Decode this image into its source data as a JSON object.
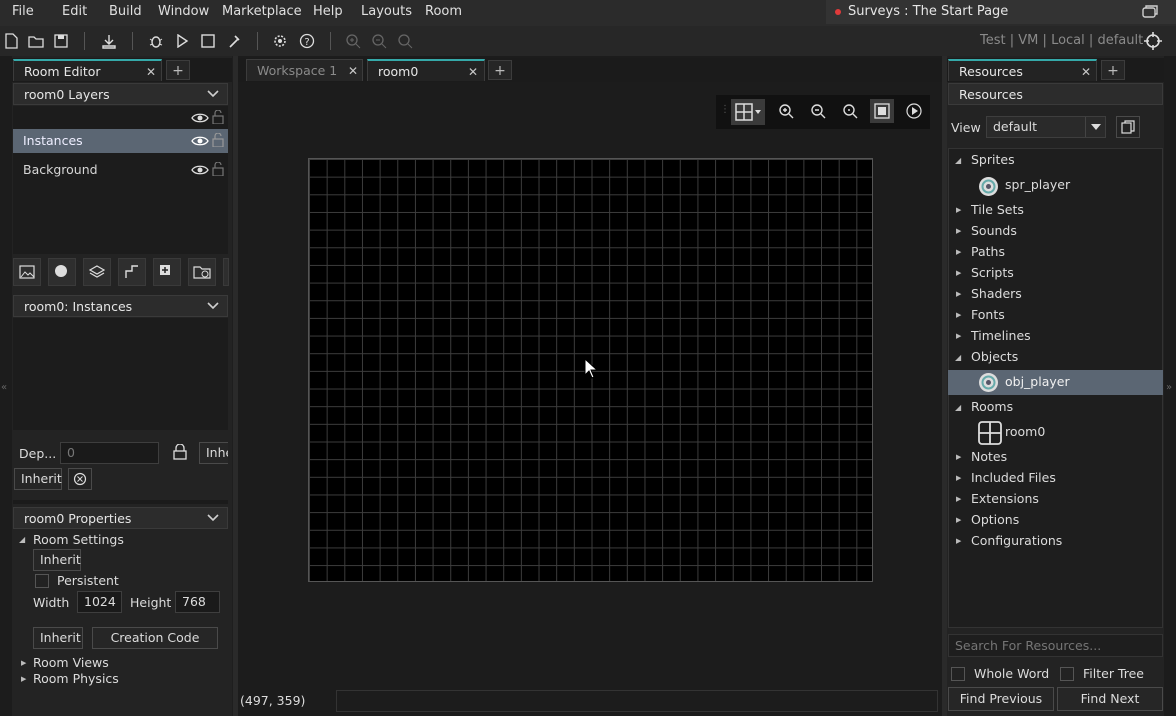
{
  "menu": [
    "File",
    "Edit",
    "Build",
    "Window",
    "Marketplace",
    "Help",
    "Layouts",
    "Room"
  ],
  "survey": {
    "label": "Surveys : The Start Page",
    "dot_color": "#e03a3a"
  },
  "toolbar": {
    "icons": [
      "new-file-icon",
      "open-folder-icon",
      "save-icon",
      "create-executable-icon",
      "debug-icon",
      "run-icon",
      "stop-icon",
      "clean-icon",
      "preferences-icon",
      "help-icon",
      "zoom-in-icon",
      "zoom-out-icon",
      "zoom-reset-icon"
    ],
    "target": {
      "platform": "Test",
      "vm": "VM",
      "local": "Local",
      "config": "default",
      "sep": "|"
    }
  },
  "left_panel": {
    "tab_label": "Room Editor",
    "layers_header": "room0 Layers",
    "layers": [
      {
        "name": "Instances",
        "selected": true
      },
      {
        "name": "Background",
        "selected": false
      }
    ],
    "instances_header": "room0: Instances",
    "depth_label": "Dep...",
    "depth_value": "0",
    "inherit_short": "Inhe",
    "inherit_label": "Inherit",
    "properties_header": "room0 Properties",
    "room_settings": "Room Settings",
    "inherit_btn": "Inherit",
    "persistent": "Persistent",
    "width_label": "Width",
    "width_value": "1024",
    "height_label": "Height",
    "height_value": "768",
    "inherit_btn2": "Inherit",
    "creation_code": "Creation Code",
    "room_views": "Room Views",
    "room_physics": "Room Physics",
    "accent": "#35a9a9"
  },
  "center": {
    "tabs": [
      {
        "label": "Workspace 1",
        "active": false
      },
      {
        "label": "room0",
        "active": true
      }
    ],
    "coords": "(497, 359)",
    "canvas_color": "#000000",
    "grid_color": "#4a4a4a"
  },
  "right_panel": {
    "tab_label": "Resources",
    "header": "Resources",
    "view_label": "View",
    "view_value": "default",
    "tree": [
      {
        "label": "Sprites",
        "expanded": true,
        "children": [
          {
            "label": "spr_player",
            "icon": "sprite-icon"
          }
        ]
      },
      {
        "label": "Tile Sets",
        "expanded": false
      },
      {
        "label": "Sounds",
        "expanded": false
      },
      {
        "label": "Paths",
        "expanded": false
      },
      {
        "label": "Scripts",
        "expanded": false
      },
      {
        "label": "Shaders",
        "expanded": false
      },
      {
        "label": "Fonts",
        "expanded": false
      },
      {
        "label": "Timelines",
        "expanded": false
      },
      {
        "label": "Objects",
        "expanded": true,
        "children": [
          {
            "label": "obj_player",
            "icon": "object-icon",
            "selected": true
          }
        ]
      },
      {
        "label": "Rooms",
        "expanded": true,
        "children": [
          {
            "label": "room0",
            "icon": "room-icon"
          }
        ]
      },
      {
        "label": "Notes",
        "expanded": false
      },
      {
        "label": "Included Files",
        "expanded": false
      },
      {
        "label": "Extensions",
        "expanded": false
      },
      {
        "label": "Options",
        "expanded": false
      },
      {
        "label": "Configurations",
        "expanded": false
      }
    ],
    "search_placeholder": "Search For Resources...",
    "whole_word": "Whole Word",
    "filter_tree": "Filter Tree",
    "find_previous": "Find Previous",
    "find_next": "Find Next"
  }
}
